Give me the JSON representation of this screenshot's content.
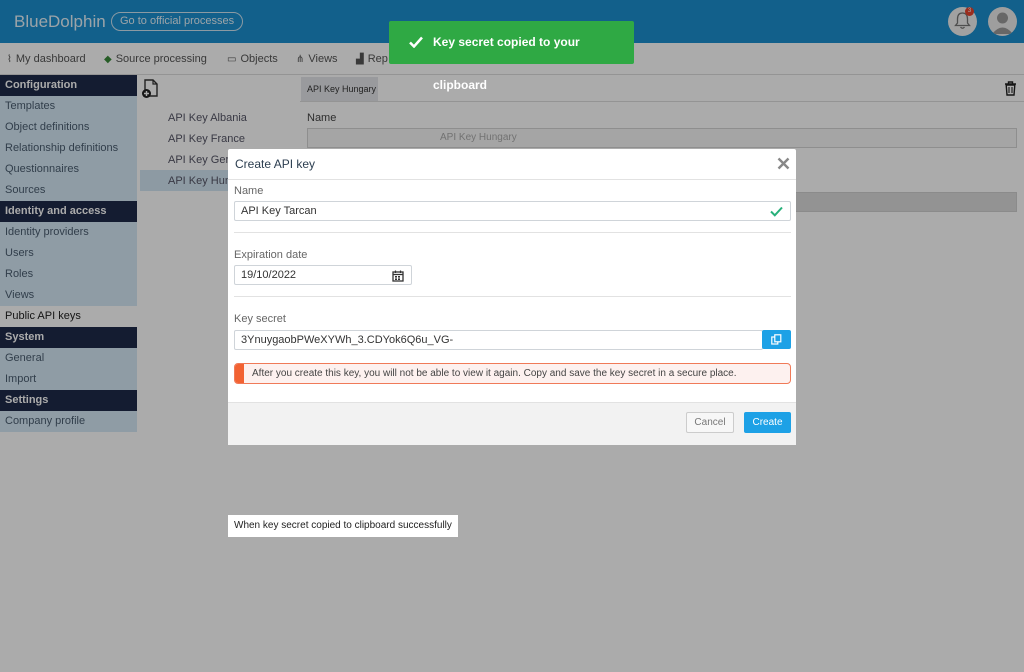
{
  "app": {
    "name": "BlueDolphin",
    "official_processes_label": "Go to official processes",
    "notification_count": "3"
  },
  "nav": [
    {
      "label": "My dashboard",
      "icon": "pulse-icon"
    },
    {
      "label": "Source processing",
      "icon": "leaf-icon"
    },
    {
      "label": "Objects",
      "icon": "objects-icon"
    },
    {
      "label": "Views",
      "icon": "views-icon"
    },
    {
      "label": "Rep",
      "icon": "reports-icon"
    }
  ],
  "sidebar": {
    "configuration": {
      "heading": "Configuration",
      "items": [
        "Templates",
        "Object definitions",
        "Relationship definitions",
        "Questionnaires",
        "Sources"
      ]
    },
    "identity": {
      "heading": "Identity and access",
      "items": [
        "Identity providers",
        "Users",
        "Roles",
        "Views",
        "Public API keys"
      ]
    },
    "system": {
      "heading": "System",
      "items": [
        "General",
        "Import"
      ]
    },
    "settings": {
      "heading": "Settings",
      "items": [
        "Company profile"
      ]
    }
  },
  "api_keys": {
    "items": [
      "API Key Albania",
      "API Key France",
      "API Key Gerr",
      "API Key Hung"
    ],
    "selected_tab": "API Key Hungary"
  },
  "detail": {
    "name_label": "Name",
    "name_value": "API Key Hungary"
  },
  "toast": {
    "message": "Key secret copied to your clipboard"
  },
  "modal": {
    "title": "Create API key",
    "name_label": "Name",
    "name_value": "API Key Tarcan",
    "expiration_label": "Expiration date",
    "expiration_value": "19/10/2022",
    "secret_label": "Key secret",
    "secret_value": "3YnuygaobPWeXYWh_3.CDYok6Q6u_VG-",
    "warning": "After you create this key, you will not be able to view it again. Copy and save the key secret in a secure place.",
    "cancel_label": "Cancel",
    "create_label": "Create"
  },
  "caption": "When key secret copied to clipboard successfully",
  "colors": {
    "brand": "#1b8fcf",
    "toast": "#2fa944",
    "primary_button": "#1da1e6",
    "warning": "#f26232",
    "sidebar_heading": "#1f2b4a"
  }
}
